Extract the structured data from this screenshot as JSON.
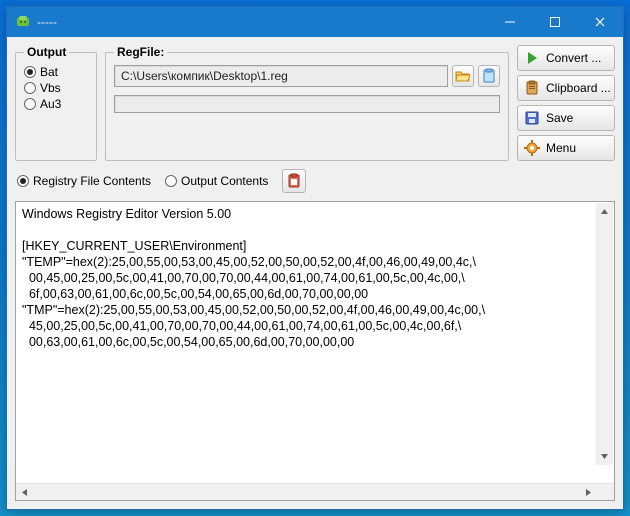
{
  "window": {
    "title": "-----"
  },
  "output": {
    "legend": "Output",
    "options": [
      "Bat",
      "Vbs",
      "Au3"
    ],
    "selected": "Bat"
  },
  "regfile": {
    "legend": "RegFile:",
    "path": "C:\\Users\\компик\\Desktop\\1.reg"
  },
  "sidebuttons": {
    "convert": "Convert ...",
    "clipboard": "Clipboard ...",
    "save": "Save",
    "menu": "Menu"
  },
  "midrow": {
    "registry_contents": "Registry File Contents",
    "output_contents": "Output Contents",
    "selected": "registry"
  },
  "editor": {
    "text": "Windows Registry Editor Version 5.00\n\n[HKEY_CURRENT_USER\\Environment]\n\"TEMP\"=hex(2):25,00,55,00,53,00,45,00,52,00,50,00,52,00,4f,00,46,00,49,00,4c,\\\n  00,45,00,25,00,5c,00,41,00,70,00,70,00,44,00,61,00,74,00,61,00,5c,00,4c,00,\\\n  6f,00,63,00,61,00,6c,00,5c,00,54,00,65,00,6d,00,70,00,00,00\n\"TMP\"=hex(2):25,00,55,00,53,00,45,00,52,00,50,00,52,00,4f,00,46,00,49,00,4c,00,\\\n  45,00,25,00,5c,00,41,00,70,00,70,00,44,00,61,00,74,00,61,00,5c,00,4c,00,6f,\\\n  00,63,00,61,00,6c,00,5c,00,54,00,65,00,6d,00,70,00,00,00"
  }
}
